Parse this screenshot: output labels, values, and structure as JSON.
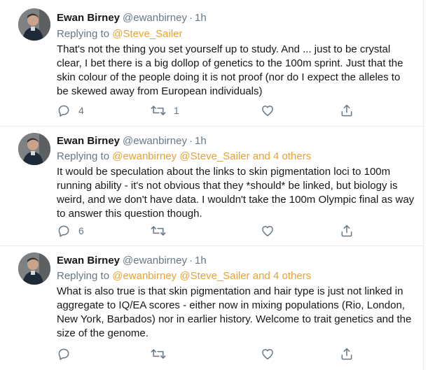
{
  "colors": {
    "mention": "#e8a233",
    "secondary_text": "#657786",
    "primary_text": "#14171a",
    "divider": "#e6ecf0"
  },
  "icons": [
    "reply-icon",
    "retweet-icon",
    "like-icon",
    "share-icon"
  ],
  "tweets": [
    {
      "name": "Ewan Birney",
      "handle": "@ewanbirney",
      "separator": "·",
      "time": "1h",
      "replying_prefix": "Replying to ",
      "mentions": [
        "@Steve_Sailer"
      ],
      "body": "That's not the thing you set yourself up to study. And ... just to be crystal clear, I bet there is a big dollop of genetics to the 100m sprint. Just that the skin colour of the people doing it is not proof (nor do I expect the alleles to be skewed away from European individuals)",
      "reply_count": "4",
      "retweet_count": "1",
      "like_count": ""
    },
    {
      "name": "Ewan Birney",
      "handle": "@ewanbirney",
      "separator": "·",
      "time": "1h",
      "replying_prefix": "Replying to ",
      "mentions": [
        "@ewanbirney",
        "@Steve_Sailer",
        "and 4 others"
      ],
      "body": "It would be speculation about the links to skin pigmentation loci to 100m running ability - it's not obvious that they *should* be linked, but biology is weird, and we don't have data. I wouldn't take the 100m Olympic final as way to answer this question though.",
      "reply_count": "6",
      "retweet_count": "",
      "like_count": ""
    },
    {
      "name": "Ewan Birney",
      "handle": "@ewanbirney",
      "separator": "·",
      "time": "1h",
      "replying_prefix": "Replying to ",
      "mentions": [
        "@ewanbirney",
        "@Steve_Sailer",
        "and 4 others"
      ],
      "body": "What is also true is that skin pigmentation and hair type is just not linked in aggregate to IQ/EA scores - either now in mixing populations (Rio, London, New York, Barbados) nor in earlier history. Welcome to trait genetics and the size of the genome.",
      "reply_count": "",
      "retweet_count": "",
      "like_count": ""
    }
  ]
}
